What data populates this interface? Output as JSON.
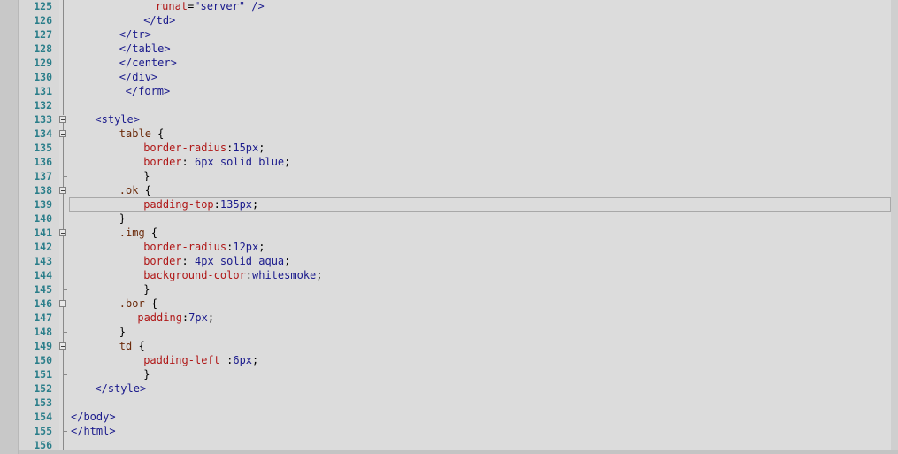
{
  "editor": {
    "lines": [
      {
        "n": "125",
        "indent": 14,
        "tokens": [
          [
            "attr",
            "runat"
          ],
          [
            "punc",
            "="
          ],
          [
            "str",
            "\"server\""
          ],
          [
            "tag",
            " />"
          ]
        ]
      },
      {
        "n": "126",
        "indent": 12,
        "tokens": [
          [
            "tag",
            "</td>"
          ]
        ]
      },
      {
        "n": "127",
        "indent": 8,
        "tokens": [
          [
            "tag",
            "</tr>"
          ]
        ]
      },
      {
        "n": "128",
        "indent": 8,
        "tokens": [
          [
            "tag",
            "</table>"
          ]
        ]
      },
      {
        "n": "129",
        "indent": 8,
        "tokens": [
          [
            "tag",
            "</center>"
          ]
        ]
      },
      {
        "n": "130",
        "indent": 8,
        "tokens": [
          [
            "tag",
            "</div>"
          ]
        ]
      },
      {
        "n": "131",
        "indent": 9,
        "tokens": [
          [
            "tag",
            "</form>"
          ]
        ]
      },
      {
        "n": "132",
        "indent": 0,
        "tokens": []
      },
      {
        "n": "133",
        "indent": 4,
        "tokens": [
          [
            "tag",
            "<style>"
          ]
        ]
      },
      {
        "n": "134",
        "indent": 8,
        "tokens": [
          [
            "sel",
            "table "
          ],
          [
            "punc",
            "{"
          ]
        ]
      },
      {
        "n": "135",
        "indent": 12,
        "tokens": [
          [
            "prop",
            "border-radius"
          ],
          [
            "punc",
            ":"
          ],
          [
            "val",
            "15px"
          ],
          [
            "punc",
            ";"
          ]
        ]
      },
      {
        "n": "136",
        "indent": 12,
        "tokens": [
          [
            "prop",
            "border"
          ],
          [
            "punc",
            ": "
          ],
          [
            "val",
            "6px solid blue"
          ],
          [
            "punc",
            ";"
          ]
        ]
      },
      {
        "n": "137",
        "indent": 12,
        "tokens": [
          [
            "punc",
            "}"
          ]
        ]
      },
      {
        "n": "138",
        "indent": 8,
        "tokens": [
          [
            "sel",
            ".ok "
          ],
          [
            "punc",
            "{"
          ]
        ]
      },
      {
        "n": "139",
        "indent": 12,
        "tokens": [
          [
            "prop",
            "padding-top"
          ],
          [
            "punc",
            ":"
          ],
          [
            "val",
            "135px"
          ],
          [
            "punc",
            ";"
          ]
        ]
      },
      {
        "n": "140",
        "indent": 8,
        "tokens": [
          [
            "punc",
            "}"
          ]
        ]
      },
      {
        "n": "141",
        "indent": 8,
        "tokens": [
          [
            "sel",
            ".img "
          ],
          [
            "punc",
            "{"
          ]
        ]
      },
      {
        "n": "142",
        "indent": 12,
        "tokens": [
          [
            "prop",
            "border-radius"
          ],
          [
            "punc",
            ":"
          ],
          [
            "val",
            "12px"
          ],
          [
            "punc",
            ";"
          ]
        ]
      },
      {
        "n": "143",
        "indent": 12,
        "tokens": [
          [
            "prop",
            "border"
          ],
          [
            "punc",
            ": "
          ],
          [
            "val",
            "4px solid aqua"
          ],
          [
            "punc",
            ";"
          ]
        ]
      },
      {
        "n": "144",
        "indent": 12,
        "tokens": [
          [
            "prop",
            "background-color"
          ],
          [
            "punc",
            ":"
          ],
          [
            "val",
            "whitesmoke"
          ],
          [
            "punc",
            ";"
          ]
        ]
      },
      {
        "n": "145",
        "indent": 12,
        "tokens": [
          [
            "punc",
            "}"
          ]
        ]
      },
      {
        "n": "146",
        "indent": 8,
        "tokens": [
          [
            "sel",
            ".bor "
          ],
          [
            "punc",
            "{"
          ]
        ]
      },
      {
        "n": "147",
        "indent": 11,
        "tokens": [
          [
            "prop",
            "padding"
          ],
          [
            "punc",
            ":"
          ],
          [
            "val",
            "7px"
          ],
          [
            "punc",
            ";"
          ]
        ]
      },
      {
        "n": "148",
        "indent": 8,
        "tokens": [
          [
            "punc",
            "}"
          ]
        ]
      },
      {
        "n": "149",
        "indent": 8,
        "tokens": [
          [
            "sel",
            "td "
          ],
          [
            "punc",
            "{"
          ]
        ]
      },
      {
        "n": "150",
        "indent": 12,
        "tokens": [
          [
            "prop",
            "padding-left "
          ],
          [
            "punc",
            ":"
          ],
          [
            "val",
            "6px"
          ],
          [
            "punc",
            ";"
          ]
        ]
      },
      {
        "n": "151",
        "indent": 12,
        "tokens": [
          [
            "punc",
            "}"
          ]
        ]
      },
      {
        "n": "152",
        "indent": 4,
        "tokens": [
          [
            "tag",
            "</style>"
          ]
        ]
      },
      {
        "n": "153",
        "indent": 0,
        "tokens": []
      },
      {
        "n": "154",
        "indent": 0,
        "tokens": [
          [
            "tag",
            "</body>"
          ]
        ]
      },
      {
        "n": "155",
        "indent": 0,
        "tokens": [
          [
            "tag",
            "</html>"
          ]
        ]
      },
      {
        "n": "156",
        "indent": 0,
        "tokens": []
      }
    ],
    "fold_markers": [
      "133",
      "134",
      "138",
      "141",
      "146",
      "149"
    ],
    "current_line": "139"
  }
}
